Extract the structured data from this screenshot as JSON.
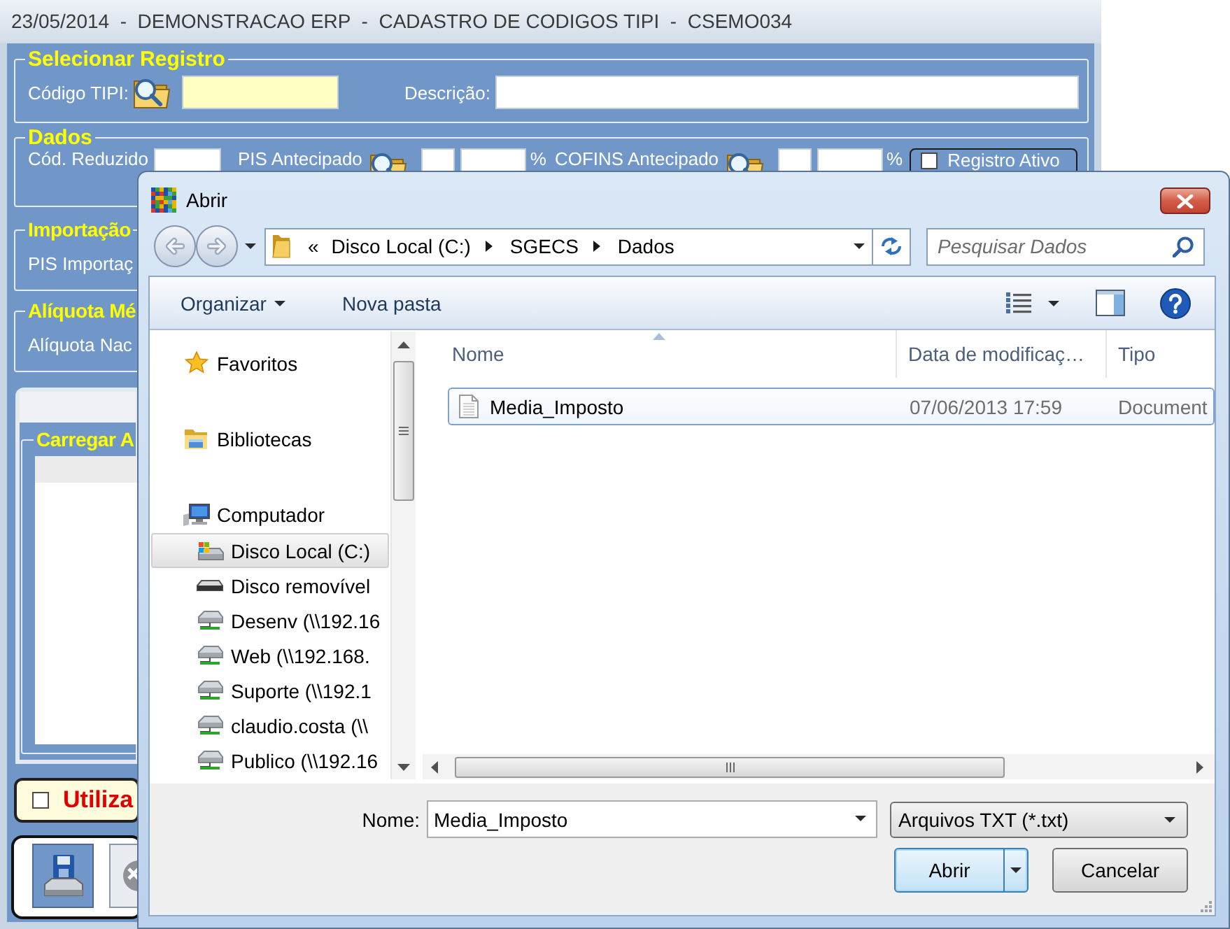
{
  "main_window": {
    "title": "23/05/2014  -  DEMONSTRACAO ERP  -  CADASTRO DE CODIGOS TIPI  -  CSEMO034",
    "groups": [
      {
        "legend": "Selecionar Registro",
        "fields": [
          {
            "kind": "lookup",
            "label": "Código TIPI:",
            "required": true
          },
          {
            "kind": "text",
            "label": "Descrição:",
            "required": false
          }
        ]
      },
      {
        "legend": "Dados",
        "fields": [
          {
            "kind": "text",
            "label": "Cód. Reduzido",
            "required": false
          },
          {
            "kind": "percent_lookup",
            "label": "PIS Antecipado",
            "unit": "%"
          },
          {
            "kind": "percent_lookup",
            "label": "COFINS Antecipado",
            "unit": "%"
          },
          {
            "kind": "checkbox",
            "label": "Registro Ativo",
            "checked": false
          }
        ]
      },
      {
        "legend": "Importação",
        "fields": [
          {
            "label": "PIS Importaç"
          }
        ]
      },
      {
        "legend": "Alíquota Mé",
        "fields": [
          {
            "label": "Alíquota Nac"
          }
        ]
      }
    ],
    "load_panel": {
      "legend": "Carregar A"
    },
    "option": {
      "label": "Utiliza",
      "checked": false
    },
    "action_buttons": [
      {
        "kind": "floppy"
      },
      {
        "kind": "x_circle"
      }
    ]
  },
  "open_dialog": {
    "title": "Abrir",
    "address": {
      "overflow": "«",
      "segments": [
        "Disco Local (C:)",
        "SGECS",
        "Dados"
      ]
    },
    "search": {
      "placeholder": "Pesquisar Dados"
    },
    "toolbar": [
      {
        "kind": "menu",
        "label": "Organizar"
      },
      {
        "kind": "button",
        "label": "Nova pasta"
      }
    ],
    "navigation": [
      {
        "kind": "favorites",
        "label": "Favoritos",
        "selected": false
      },
      {
        "kind": "libraries",
        "label": "Bibliotecas",
        "selected": false
      },
      {
        "kind": "computer",
        "label": "Computador",
        "selected": false,
        "children": [
          {
            "kind": "local_disk",
            "label": "Disco Local (C:)",
            "selected": true
          },
          {
            "kind": "removable",
            "label": "Disco removível",
            "selected": false
          },
          {
            "kind": "network",
            "label": "Desenv (\\\\192.16",
            "selected": false
          },
          {
            "kind": "network",
            "label": "Web (\\\\192.168.",
            "selected": false
          },
          {
            "kind": "network",
            "label": "Suporte (\\\\192.1",
            "selected": false
          },
          {
            "kind": "network",
            "label": "claudio.costa (\\\\",
            "selected": false
          },
          {
            "kind": "network",
            "label": "Publico (\\\\192.16",
            "selected": false
          }
        ]
      }
    ],
    "columns": [
      {
        "label": "Nome",
        "sorted": true
      },
      {
        "label": "Data de modificaç…",
        "sorted": false
      },
      {
        "label": "Tipo",
        "sorted": false
      }
    ],
    "files": [
      {
        "name": "Media_Imposto",
        "modified": "07/06/2013 17:59",
        "type": "Document",
        "focused": true
      }
    ],
    "file_name": {
      "label": "Nome:",
      "value": "Media_Imposto"
    },
    "file_type": {
      "value": "Arquivos TXT (*.txt)"
    },
    "buttons": [
      {
        "kind": "split",
        "label": "Abrir",
        "default": true
      },
      {
        "kind": "plain",
        "label": "Cancelar",
        "default": false
      }
    ]
  }
}
